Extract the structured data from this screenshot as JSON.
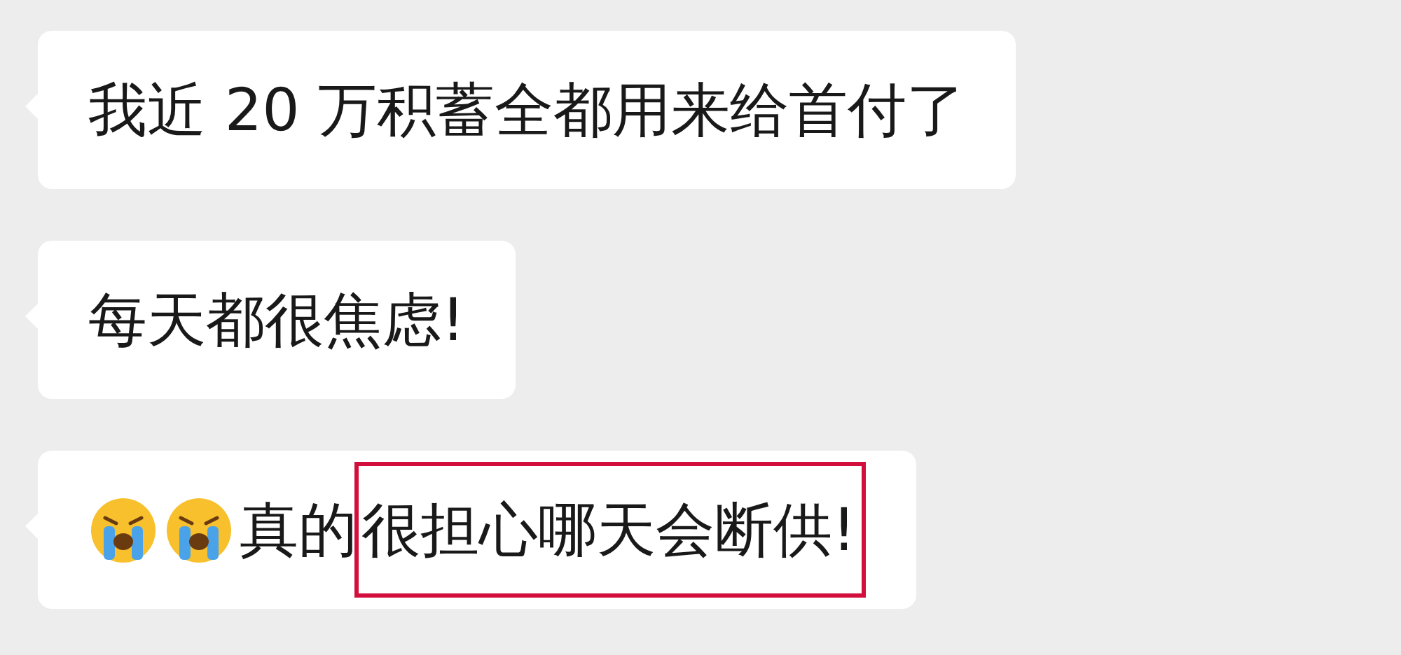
{
  "messages": [
    {
      "parts": [
        {
          "kind": "text",
          "text": "我近 20 万积蓄全都用来给首付了"
        }
      ]
    },
    {
      "parts": [
        {
          "kind": "text",
          "text": "每天都很焦虑!"
        }
      ]
    },
    {
      "parts": [
        {
          "kind": "emoji"
        },
        {
          "kind": "emoji"
        },
        {
          "kind": "text",
          "text": "真的"
        },
        {
          "kind": "highlight",
          "text": "很担心哪天会断供!"
        }
      ]
    }
  ]
}
